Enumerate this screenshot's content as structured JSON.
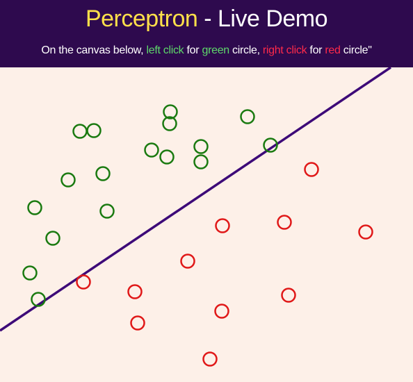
{
  "header": {
    "title_part1": "Perceptron",
    "title_sep": " - ",
    "title_part2": "Live Demo",
    "sub_prefix": "On the canvas below, ",
    "sub_left_click": "left click",
    "sub_for1": " for ",
    "sub_green": "green",
    "sub_circle1": " circle, ",
    "sub_right_click": "right click",
    "sub_for2": " for ",
    "sub_red": "red",
    "sub_circle2": " circle\""
  },
  "colors": {
    "header_bg": "#2e0a4e",
    "title_accent": "#ffe04a",
    "green_text": "#5ed86a",
    "red_text": "#ff2a4a",
    "canvas_bg": "#fdf0e8",
    "green_point": "#1a7a10",
    "red_point": "#e01818",
    "line": "#3d0a78"
  },
  "chart_data": {
    "type": "scatter",
    "xlim": [
      0,
      594
    ],
    "ylim": [
      0,
      453
    ],
    "series": [
      {
        "points": [
          [
            245,
            64
          ],
          [
            115,
            92
          ],
          [
            135,
            91
          ],
          [
            244,
            81
          ],
          [
            356,
            71
          ],
          [
            218,
            119
          ],
          [
            240,
            129
          ],
          [
            289,
            114
          ],
          [
            289,
            136
          ],
          [
            389,
            112
          ],
          [
            148,
            153
          ],
          [
            98,
            162
          ],
          [
            50,
            202
          ],
          [
            154,
            207
          ],
          [
            76,
            246
          ],
          [
            43,
            296
          ],
          [
            55,
            334
          ]
        ]
      },
      {
        "points": [
          [
            448,
            147
          ],
          [
            320,
            228
          ],
          [
            409,
            223
          ],
          [
            526,
            237
          ],
          [
            270,
            279
          ],
          [
            120,
            309
          ],
          [
            194,
            323
          ],
          [
            415,
            328
          ],
          [
            319,
            351
          ],
          [
            198,
            368
          ],
          [
            302,
            420
          ]
        ]
      }
    ],
    "decision_line": [
      [
        0,
        379
      ],
      [
        562,
        0
      ]
    ]
  }
}
